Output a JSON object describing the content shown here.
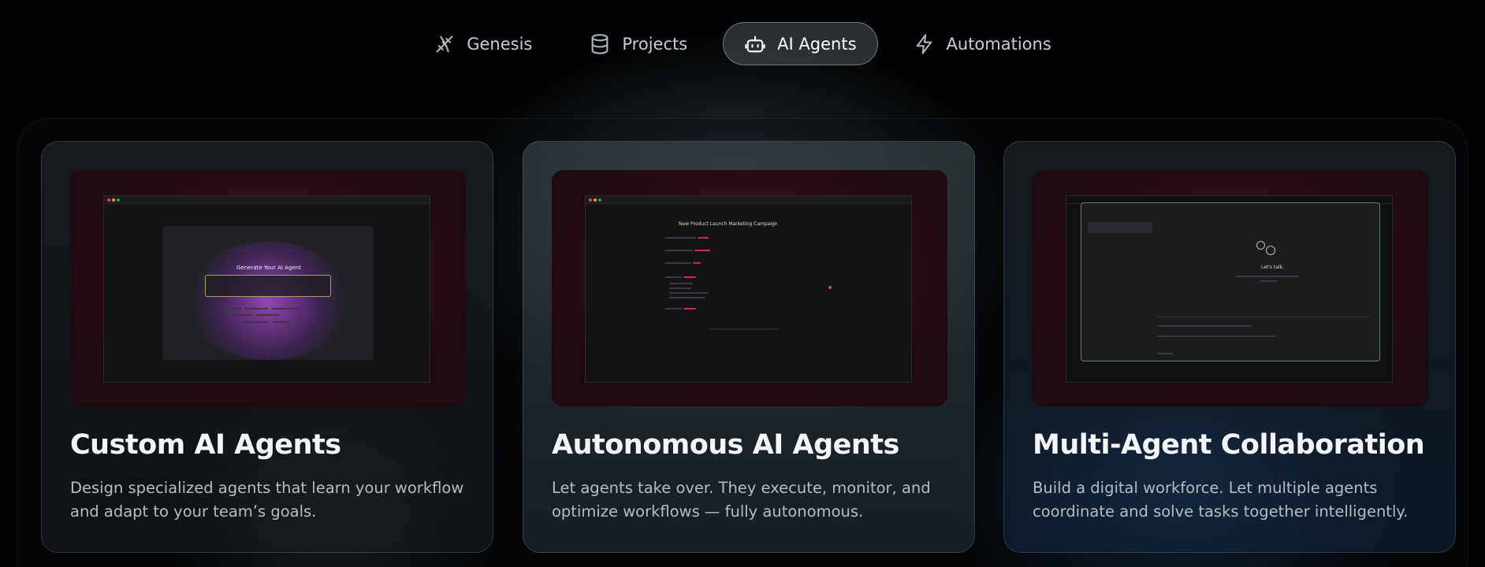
{
  "tabs": [
    {
      "label": "Genesis",
      "icon": "dna-icon",
      "active": false
    },
    {
      "label": "Projects",
      "icon": "database-icon",
      "active": false
    },
    {
      "label": "AI Agents",
      "icon": "robot-icon",
      "active": true
    },
    {
      "label": "Automations",
      "icon": "lightning-icon",
      "active": false
    }
  ],
  "cards": [
    {
      "title": "Custom AI Agents",
      "description": "Design specialized agents that learn your workflow and adapt to your team’s goals.",
      "screenshot": {
        "heading": "Generate Your AI Agent"
      }
    },
    {
      "title": "Autonomous AI Agents",
      "description": "Let agents take over. They execute, monitor, and optimize workflows — fully autonomous.",
      "screenshot": {
        "heading": "New Product Launch Marketing Campaign"
      }
    },
    {
      "title": "Multi-Agent Collaboration",
      "description": "Build a digital workforce. Let multiple agents coordinate and solve tasks together intelligently.",
      "screenshot": {
        "heading": "Let's talk."
      }
    }
  ],
  "colors": {
    "accent_pink": "#c2304f",
    "glow_purple": "#8a3dbd",
    "background": "#020304"
  }
}
